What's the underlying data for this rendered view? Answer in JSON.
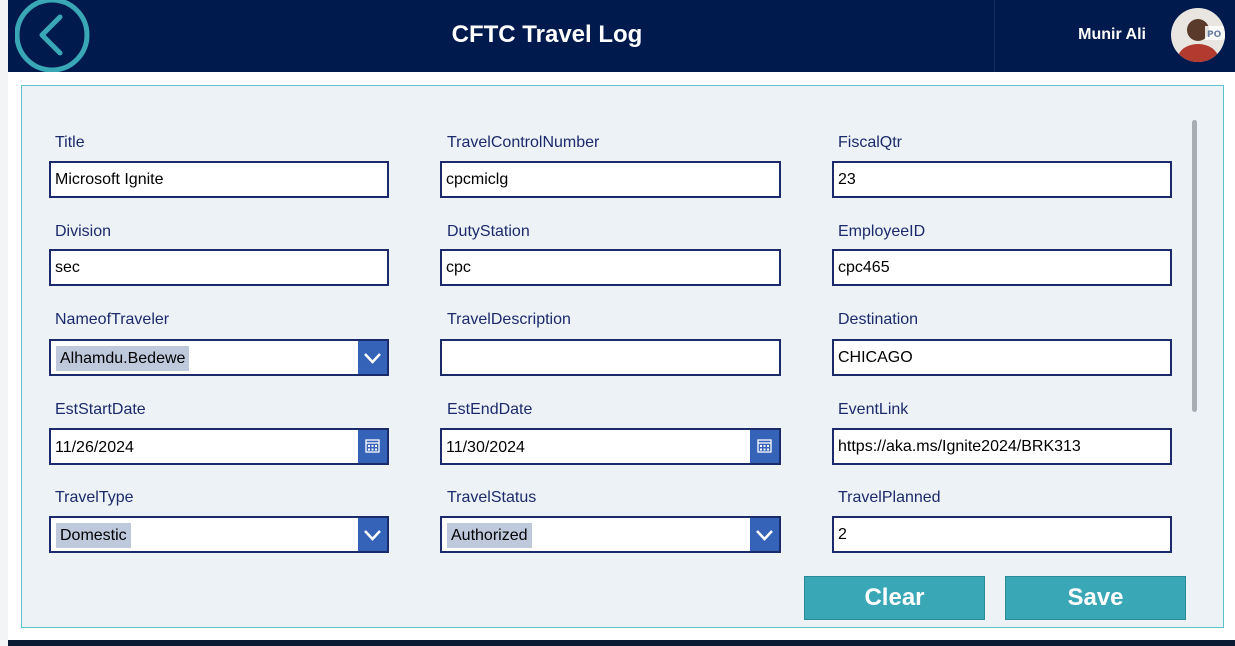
{
  "header": {
    "title": "CFTC Travel Log",
    "user_name": "Munir Ali",
    "back_icon": "chevron-left-circle-icon",
    "colors": {
      "background": "#001a4d",
      "accent": "#39a7b6"
    }
  },
  "form": {
    "title": {
      "label": "Title",
      "value": "Microsoft Ignite"
    },
    "travel_control_number": {
      "label": "TravelControlNumber",
      "value": "cpcmiclg"
    },
    "fiscal_qtr": {
      "label": "FiscalQtr",
      "value": "23"
    },
    "division": {
      "label": "Division",
      "value": "sec"
    },
    "duty_station": {
      "label": "DutyStation",
      "value": "cpc"
    },
    "employee_id": {
      "label": "EmployeeID",
      "value": "cpc465"
    },
    "name_of_traveler": {
      "label": "NameofTraveler",
      "value": "Alhamdu.Bedewe"
    },
    "travel_description": {
      "label": "TravelDescription",
      "value": ""
    },
    "destination": {
      "label": "Destination",
      "value": "CHICAGO"
    },
    "est_start_date": {
      "label": "EstStartDate",
      "value": "11/26/2024"
    },
    "est_end_date": {
      "label": "EstEndDate",
      "value": "11/30/2024"
    },
    "event_link": {
      "label": "EventLink",
      "value": "https://aka.ms/Ignite2024/BRK313"
    },
    "travel_type": {
      "label": "TravelType",
      "value": "Domestic"
    },
    "travel_status": {
      "label": "TravelStatus",
      "value": "Authorized"
    },
    "travel_planned": {
      "label": "TravelPlanned",
      "value": "2"
    }
  },
  "actions": {
    "clear_label": "Clear",
    "save_label": "Save"
  }
}
